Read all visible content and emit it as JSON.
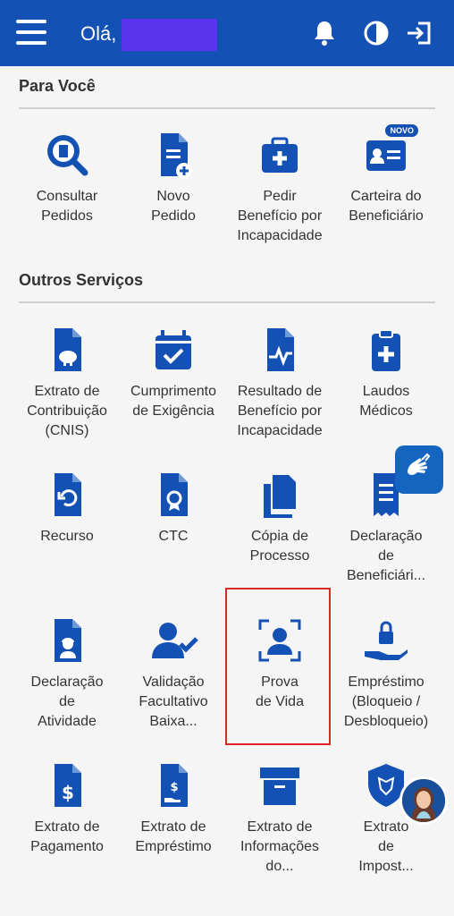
{
  "header": {
    "greeting": "Olá,"
  },
  "sections": [
    {
      "title": "Para Você",
      "items": [
        {
          "label_lines": [
            "Consultar",
            "Pedidos"
          ],
          "icon": "search-document-icon"
        },
        {
          "label_lines": [
            "Novo",
            "Pedido"
          ],
          "icon": "new-document-icon"
        },
        {
          "label_lines": [
            "Pedir",
            "Benefício por",
            "Incapacidade"
          ],
          "icon": "medical-kit-icon"
        },
        {
          "label_lines": [
            "Carteira do",
            "Beneficiário"
          ],
          "icon": "id-card-icon",
          "badge": "NOVO"
        }
      ]
    },
    {
      "title": "Outros Serviços",
      "items": [
        {
          "label_lines": [
            "Extrato de",
            "Contribuição",
            "(CNIS)"
          ],
          "icon": "piggy-document-icon"
        },
        {
          "label_lines": [
            "Cumprimento",
            "de Exigência"
          ],
          "icon": "calendar-check-icon"
        },
        {
          "label_lines": [
            "Resultado de",
            "Benefício por",
            "Incapacidade"
          ],
          "icon": "pulse-document-icon"
        },
        {
          "label_lines": [
            "Laudos",
            "Médicos"
          ],
          "icon": "clipboard-plus-icon"
        },
        {
          "label_lines": [
            "Recurso"
          ],
          "icon": "undo-document-icon"
        },
        {
          "label_lines": [
            "CTC"
          ],
          "icon": "certificate-document-icon"
        },
        {
          "label_lines": [
            "Cópia de",
            "Processo"
          ],
          "icon": "copy-icon"
        },
        {
          "label_lines": [
            "Declaração",
            "de",
            "Beneficiári..."
          ],
          "icon": "receipt-icon"
        },
        {
          "label_lines": [
            "Declaração",
            "de",
            "Atividade"
          ],
          "icon": "worker-document-icon"
        },
        {
          "label_lines": [
            "Validação",
            "Facultativo",
            "Baixa..."
          ],
          "icon": "user-check-icon"
        },
        {
          "label_lines": [
            "Prova",
            "de Vida"
          ],
          "icon": "face-scan-icon"
        },
        {
          "label_lines": [
            "Empréstimo",
            "(Bloqueio /",
            "Desbloqueio)"
          ],
          "icon": "hand-lock-icon"
        },
        {
          "label_lines": [
            "Extrato de",
            "Pagamento"
          ],
          "icon": "dollar-document-icon"
        },
        {
          "label_lines": [
            "Extrato de",
            "Empréstimo"
          ],
          "icon": "hand-dollar-document-icon"
        },
        {
          "label_lines": [
            "Extrato de",
            "Informações",
            "do..."
          ],
          "icon": "archive-box-icon"
        },
        {
          "label_lines": [
            "Extrato",
            "de",
            "Impost..."
          ],
          "icon": "lion-shield-icon"
        }
      ]
    }
  ]
}
